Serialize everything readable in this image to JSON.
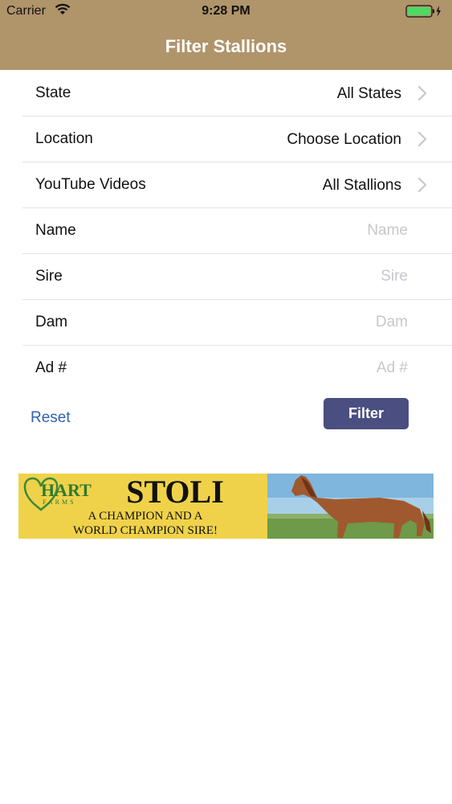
{
  "status_bar": {
    "carrier": "Carrier",
    "time": "9:28 PM",
    "wifi_icon": "wifi-icon",
    "battery_icon": "battery-charging-icon"
  },
  "nav": {
    "title": "Filter Stallions"
  },
  "filters": {
    "state": {
      "label": "State",
      "value": "All States"
    },
    "location": {
      "label": "Location",
      "value": "Choose Location"
    },
    "youtube": {
      "label": "YouTube Videos",
      "value": "All Stallions"
    },
    "name": {
      "label": "Name",
      "placeholder": "Name"
    },
    "sire": {
      "label": "Sire",
      "placeholder": "Sire"
    },
    "dam": {
      "label": "Dam",
      "placeholder": "Dam"
    },
    "ad_number": {
      "label": "Ad #",
      "placeholder": "Ad #"
    }
  },
  "actions": {
    "reset_label": "Reset",
    "filter_label": "Filter"
  },
  "ad_banner": {
    "logo_text": "HART",
    "logo_subtext": "FARMS",
    "headline": "STOLI",
    "line1": "A CHAMPION AND A",
    "line2": "WORLD CHAMPION SIRE!"
  },
  "colors": {
    "header": "#b0946a",
    "filter_button": "#4a4e80",
    "link": "#2f62b3",
    "ad_yellow": "#f0d24a"
  }
}
